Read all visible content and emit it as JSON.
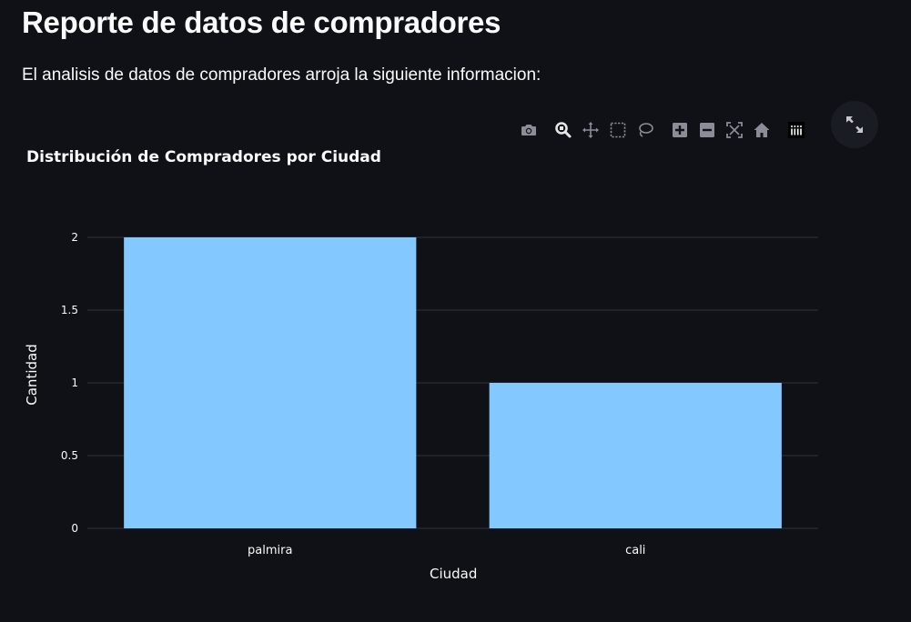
{
  "header": {
    "title": "Reporte de datos de compradores",
    "subtitle": "El analisis de datos de compradores arroja la siguiente informacion:"
  },
  "modebar": {
    "icons": [
      "camera-icon",
      "zoom-icon",
      "pan-icon",
      "box-select-icon",
      "lasso-icon",
      "zoom-in-icon",
      "zoom-out-icon",
      "autoscale-icon",
      "home-icon",
      "plotly-logo-icon"
    ],
    "fullscreen_icon": "expand-icon"
  },
  "colors": {
    "background": "#0f1117",
    "bar": "#83c9ff",
    "grid": "#31333f",
    "tick_text": "#fafafa",
    "modebar_icon": "#8a8d98"
  },
  "chart_data": {
    "type": "bar",
    "title": "Distribución de Compradores por Ciudad",
    "xlabel": "Ciudad",
    "ylabel": "Cantidad",
    "categories": [
      "palmira",
      "cali"
    ],
    "values": [
      2,
      1
    ],
    "ylim": [
      0,
      2
    ],
    "yticks": [
      "0",
      "0.5",
      "1",
      "1.5",
      "2"
    ],
    "grid": true
  }
}
